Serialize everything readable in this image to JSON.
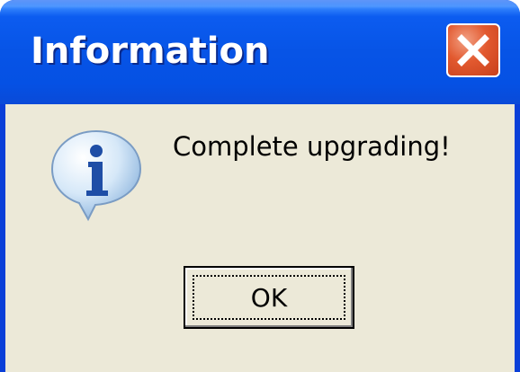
{
  "dialog": {
    "title": "Information",
    "message": "Complete upgrading!",
    "ok_label": "OK",
    "icon": "info-icon",
    "close_icon": "close-icon"
  },
  "colors": {
    "titlebar": "#0754e6",
    "close_button": "#e2592f",
    "body": "#ece9d8",
    "icon_bubble": "#cfe3f5",
    "icon_letter": "#1f4ea6"
  }
}
